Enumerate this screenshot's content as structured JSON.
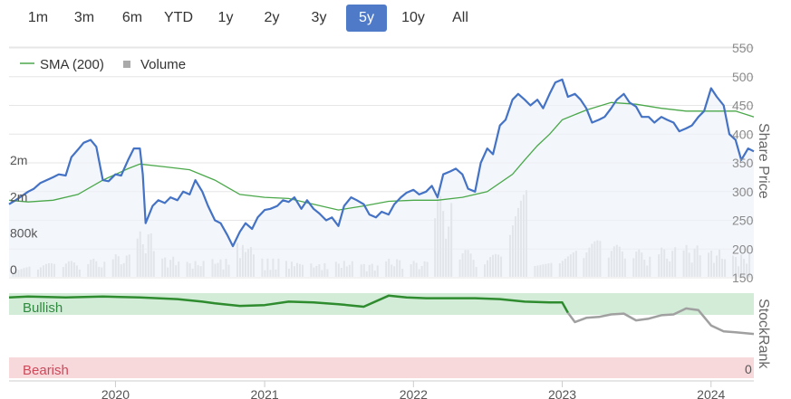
{
  "range_selector": {
    "buttons": [
      "1m",
      "3m",
      "6m",
      "YTD",
      "1y",
      "2y",
      "3y",
      "5y",
      "10y",
      "All"
    ],
    "active": "5y"
  },
  "colors": {
    "price_line": "#4472c4",
    "sma_line": "#4aa84a",
    "volume_bar": "#c6c6c6",
    "bullish_band": "#d3ecd8",
    "bearish_band": "#f7d9dc",
    "stockrank_bullish": "#2e8b2e",
    "stockrank_other": "#a0a0a0",
    "bullish_text": "#2e8b3e",
    "bearish_text": "#d0485a"
  },
  "chart_data": [
    {
      "type": "line",
      "legend": {
        "placement": "top-left",
        "entries": [
          {
            "label": "SMA (200)",
            "symbol": "line",
            "color": "#4aa84a"
          },
          {
            "label": "Volume",
            "symbol": "square",
            "color": "#aaaaaa"
          }
        ]
      },
      "ylabel": "Share Price",
      "y_ticks": [
        150,
        200,
        250,
        300,
        350,
        400,
        450,
        500,
        550
      ],
      "ylim": [
        150,
        550
      ],
      "volume_axis": {
        "ticks": [
          {
            "value": 0,
            "label": "0"
          },
          {
            "value": 800000,
            "label": "800k"
          },
          {
            "value": 1600000,
            "label": "2m"
          },
          {
            "value": 2400000,
            "label": "2m"
          }
        ],
        "ylim": [
          0,
          2400000
        ]
      },
      "x_ticks": [
        "2020",
        "2021",
        "2022",
        "2023",
        "2024"
      ],
      "xlim": [
        "2019-04-15",
        "2024-04-15"
      ],
      "grid": "horizontal",
      "series": [
        {
          "name": "Share Price",
          "x": [
            "2019-04-15",
            "2019-05-01",
            "2019-06-01",
            "2019-06-15",
            "2019-07-01",
            "2019-08-01",
            "2019-08-15",
            "2019-09-01",
            "2019-09-15",
            "2019-10-01",
            "2019-10-15",
            "2019-11-01",
            "2019-11-15",
            "2019-12-01",
            "2019-12-15",
            "2020-01-01",
            "2020-01-15",
            "2020-02-01",
            "2020-02-15",
            "2020-03-01",
            "2020-03-08",
            "2020-03-15",
            "2020-04-01",
            "2020-04-15",
            "2020-05-01",
            "2020-05-15",
            "2020-06-01",
            "2020-06-15",
            "2020-07-01",
            "2020-07-15",
            "2020-08-01",
            "2020-08-15",
            "2020-09-01",
            "2020-09-15",
            "2020-10-01",
            "2020-10-15",
            "2020-11-01",
            "2020-11-15",
            "2020-12-01",
            "2020-12-15",
            "2021-01-01",
            "2021-01-15",
            "2021-02-01",
            "2021-02-15",
            "2021-03-01",
            "2021-03-15",
            "2021-04-01",
            "2021-04-15",
            "2021-05-01",
            "2021-05-15",
            "2021-06-01",
            "2021-06-15",
            "2021-07-01",
            "2021-07-15",
            "2021-08-01",
            "2021-08-15",
            "2021-09-01",
            "2021-09-15",
            "2021-10-01",
            "2021-10-15",
            "2021-11-01",
            "2021-11-15",
            "2021-12-01",
            "2021-12-15",
            "2022-01-01",
            "2022-01-15",
            "2022-02-01",
            "2022-02-15",
            "2022-03-01",
            "2022-03-15",
            "2022-04-01",
            "2022-04-15",
            "2022-05-01",
            "2022-05-15",
            "2022-06-01",
            "2022-06-15",
            "2022-07-01",
            "2022-07-15",
            "2022-08-01",
            "2022-08-15",
            "2022-09-01",
            "2022-09-15",
            "2022-10-01",
            "2022-10-15",
            "2022-11-01",
            "2022-11-15",
            "2022-12-01",
            "2022-12-15",
            "2023-01-01",
            "2023-01-15",
            "2023-02-01",
            "2023-02-15",
            "2023-03-01",
            "2023-03-15",
            "2023-04-01",
            "2023-04-15",
            "2023-05-01",
            "2023-05-15",
            "2023-06-01",
            "2023-06-15",
            "2023-07-01",
            "2023-07-15",
            "2023-08-01",
            "2023-08-15",
            "2023-09-01",
            "2023-09-15",
            "2023-10-01",
            "2023-10-15",
            "2023-11-01",
            "2023-11-15",
            "2023-12-01",
            "2023-12-15",
            "2024-01-01",
            "2024-01-15",
            "2024-02-01",
            "2024-02-15",
            "2024-03-01",
            "2024-03-15",
            "2024-04-01",
            "2024-04-15"
          ],
          "values": [
            278,
            285,
            300,
            305,
            315,
            325,
            330,
            328,
            360,
            373,
            385,
            390,
            378,
            320,
            318,
            330,
            328,
            355,
            375,
            375,
            330,
            245,
            275,
            285,
            280,
            290,
            285,
            300,
            295,
            320,
            300,
            275,
            250,
            245,
            225,
            205,
            230,
            245,
            235,
            255,
            268,
            270,
            275,
            285,
            282,
            290,
            270,
            285,
            270,
            262,
            250,
            255,
            240,
            275,
            290,
            285,
            278,
            260,
            255,
            265,
            260,
            278,
            290,
            298,
            303,
            295,
            300,
            310,
            290,
            330,
            335,
            340,
            330,
            305,
            300,
            350,
            375,
            365,
            415,
            425,
            460,
            470,
            460,
            450,
            460,
            445,
            470,
            490,
            495,
            465,
            470,
            460,
            445,
            420,
            425,
            430,
            445,
            460,
            470,
            455,
            448,
            430,
            430,
            420,
            430,
            425,
            420,
            405,
            410,
            415,
            430,
            440,
            480,
            465,
            450,
            400,
            390,
            355,
            375,
            370
          ],
          "color": "#4472c4"
        },
        {
          "name": "SMA (200)",
          "x": [
            "2019-04-15",
            "2019-06-01",
            "2019-08-01",
            "2019-10-01",
            "2019-12-01",
            "2020-02-01",
            "2020-03-01",
            "2020-05-01",
            "2020-07-01",
            "2020-09-01",
            "2020-11-01",
            "2021-01-01",
            "2021-03-01",
            "2021-05-01",
            "2021-07-01",
            "2021-09-01",
            "2021-11-01",
            "2022-01-01",
            "2022-03-01",
            "2022-05-01",
            "2022-07-01",
            "2022-09-01",
            "2022-10-01",
            "2022-11-01",
            "2022-12-01",
            "2023-01-01",
            "2023-03-01",
            "2023-05-01",
            "2023-07-01",
            "2023-09-01",
            "2023-11-01",
            "2024-01-01",
            "2024-03-01",
            "2024-04-15"
          ],
          "values": [
            285,
            282,
            285,
            295,
            320,
            340,
            348,
            343,
            338,
            320,
            295,
            290,
            288,
            278,
            268,
            275,
            283,
            285,
            285,
            290,
            300,
            330,
            355,
            380,
            400,
            425,
            442,
            455,
            452,
            445,
            440,
            440,
            440,
            430
          ],
          "color": "#4aa84a"
        },
        {
          "name": "Volume",
          "type": "bar",
          "x": [
            "2019-05",
            "2019-07",
            "2019-09",
            "2019-11",
            "2020-01",
            "2020-03",
            "2020-05",
            "2020-07",
            "2020-09",
            "2020-11",
            "2021-01",
            "2021-03",
            "2021-05",
            "2021-07",
            "2021-09",
            "2021-11",
            "2022-01",
            "2022-03",
            "2022-05",
            "2022-07",
            "2022-09",
            "2022-11",
            "2023-01",
            "2023-03",
            "2023-05",
            "2023-07",
            "2023-09",
            "2023-11",
            "2024-01",
            "2024-03"
          ],
          "values": [
            250000,
            300000,
            350000,
            400000,
            500000,
            1000000,
            450000,
            350000,
            400000,
            750000,
            400000,
            350000,
            300000,
            350000,
            300000,
            400000,
            350000,
            1800000,
            600000,
            500000,
            2000000,
            650000,
            700000,
            800000,
            700000,
            600000,
            650000,
            700000,
            600000,
            500000
          ],
          "color": "#c6c6c6"
        }
      ]
    },
    {
      "type": "area",
      "ylabel": "StockRank",
      "y_ticks": [
        0
      ],
      "ylim": [
        0,
        100
      ],
      "bands": [
        {
          "label": "Bullish",
          "range": [
            85,
            100
          ],
          "color": "#d3ecd8"
        },
        {
          "label": "Bearish",
          "range": [
            0,
            15
          ],
          "color": "#f7d9dc"
        }
      ],
      "x_ticks": [
        "2020",
        "2021",
        "2022",
        "2023",
        "2024"
      ],
      "xlim": [
        "2019-04-15",
        "2024-04-15"
      ],
      "series": [
        {
          "name": "StockRank",
          "x": [
            "2019-04-15",
            "2019-06-01",
            "2019-09-01",
            "2019-12-01",
            "2020-03-01",
            "2020-06-01",
            "2020-08-01",
            "2020-09-01",
            "2020-11-01",
            "2021-01-01",
            "2021-03-01",
            "2021-05-01",
            "2021-07-01",
            "2021-09-01",
            "2021-11-01",
            "2021-12-15",
            "2022-02-01",
            "2022-04-01",
            "2022-06-01",
            "2022-08-01",
            "2022-10-01",
            "2022-12-01",
            "2023-01-01",
            "2023-01-15",
            "2023-02-01",
            "2023-03-01",
            "2023-04-01",
            "2023-05-01",
            "2023-06-01",
            "2023-07-01",
            "2023-08-01",
            "2023-09-01",
            "2023-10-01",
            "2023-11-01",
            "2023-12-01",
            "2024-01-01",
            "2024-02-01",
            "2024-03-01",
            "2024-04-15"
          ],
          "values": [
            95,
            96,
            95,
            96,
            95,
            93,
            90,
            88,
            85,
            86,
            90,
            89,
            87,
            84,
            97,
            95,
            94,
            94,
            94,
            93,
            90,
            89,
            89,
            77,
            66,
            71,
            72,
            75,
            76,
            68,
            70,
            74,
            75,
            82,
            80,
            62,
            55,
            54,
            52
          ],
          "bullish_until": "2023-01-15"
        }
      ]
    }
  ]
}
